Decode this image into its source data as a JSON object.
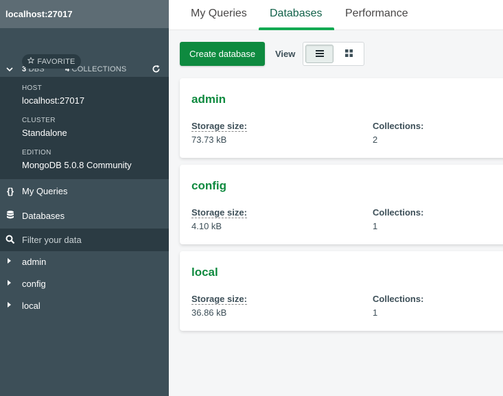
{
  "sidebar": {
    "title": "localhost:27017",
    "stats": {
      "dbs_count": "3",
      "dbs_label": "DBS",
      "collections_count": "4",
      "collections_label": "COLLECTIONS"
    },
    "favorite_label": "FAVORITE",
    "info": [
      {
        "label": "HOST",
        "value": "localhost:27017"
      },
      {
        "label": "CLUSTER",
        "value": "Standalone"
      },
      {
        "label": "EDITION",
        "value": "MongoDB 5.0.8 Community"
      }
    ],
    "nav": [
      {
        "label": "My Queries",
        "icon": "curly-braces-icon",
        "glyph": "{}"
      },
      {
        "label": "Databases",
        "icon": "database-icon"
      }
    ],
    "filter_placeholder": "Filter your data",
    "databases": [
      {
        "label": "admin"
      },
      {
        "label": "config"
      },
      {
        "label": "local"
      }
    ]
  },
  "tabs": [
    {
      "label": "My Queries",
      "active": false
    },
    {
      "label": "Databases",
      "active": true
    },
    {
      "label": "Performance",
      "active": false
    }
  ],
  "toolbar": {
    "create_label": "Create database",
    "view_label": "View",
    "view_mode": "list"
  },
  "cards": [
    {
      "name": "admin",
      "storage_label": "Storage size:",
      "storage_value": "73.73 kB",
      "collections_label": "Collections:",
      "collections_value": "2"
    },
    {
      "name": "config",
      "storage_label": "Storage size:",
      "storage_value": "4.10 kB",
      "collections_label": "Collections:",
      "collections_value": "1"
    },
    {
      "name": "local",
      "storage_label": "Storage size:",
      "storage_value": "36.86 kB",
      "collections_label": "Collections:",
      "collections_value": "1"
    }
  ],
  "colors": {
    "accent": "#13aa52",
    "sidebar": "#3d4f58",
    "sidebar_dark": "#2b3b43"
  }
}
